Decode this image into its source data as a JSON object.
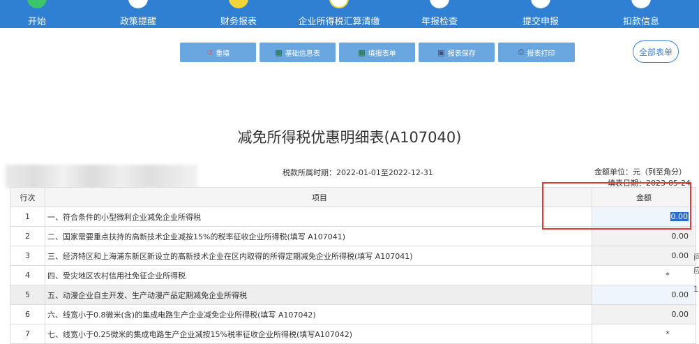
{
  "nav": {
    "steps": [
      {
        "label": "开始",
        "state": "done"
      },
      {
        "label": "政策提醒",
        "state": "todo"
      },
      {
        "label": "财务报表",
        "state": "active"
      },
      {
        "label": "企业所得税汇算清缴",
        "state": "current"
      },
      {
        "label": "年报检查",
        "state": "todo"
      },
      {
        "label": "提交申报",
        "state": "todo"
      },
      {
        "label": "扣款信息",
        "state": "todo"
      }
    ]
  },
  "toolbar": {
    "refill": "重填",
    "basic_info": "基础信息表",
    "fill_form": "填报表单",
    "save": "报表保存",
    "print": "报表打印",
    "all_forms": "全部表单"
  },
  "report": {
    "title": "减免所得税优惠明细表(A107040)",
    "period": "税款所属时期：2022-01-01至2022-12-31",
    "unit": "金额单位：元（列至角分）",
    "fill_date": "填表日期：2023-05-24"
  },
  "table": {
    "headers": {
      "no": "行次",
      "item": "项目",
      "amount": "金额"
    },
    "rows": [
      {
        "no": "1",
        "item": "一、符合条件的小型微利企业减免企业所得税",
        "amount": "0.00"
      },
      {
        "no": "2",
        "item": "二、国家需要重点扶持的高新技术企业减按15%的税率征收企业所得税(填写 A107041)",
        "amount": "0.00"
      },
      {
        "no": "3",
        "item": "三、经济特区和上海浦东新区新设立的高新技术企业在区内取得的所得定期减免企业所得税(填写 A107041)",
        "amount": "0.00"
      },
      {
        "no": "4",
        "item": "四、受灾地区农村信用社免征企业所得税",
        "amount": "*"
      },
      {
        "no": "5",
        "item": "五、动漫企业自主开发、生产动漫产品定期减免企业所得税",
        "amount": "0.00"
      },
      {
        "no": "6",
        "item": "六、线宽小于0.8微米(含)的集成电路生产企业减免企业所得税(填写 A107042)",
        "amount": "0.00"
      },
      {
        "no": "7",
        "item": "七、线宽小于0.25微米的集成电路生产企业减按15%税率征收企业所得税(填写A107042)",
        "amount": "*"
      }
    ]
  },
  "side_fragments": [
    "问",
    "应",
    "12"
  ]
}
